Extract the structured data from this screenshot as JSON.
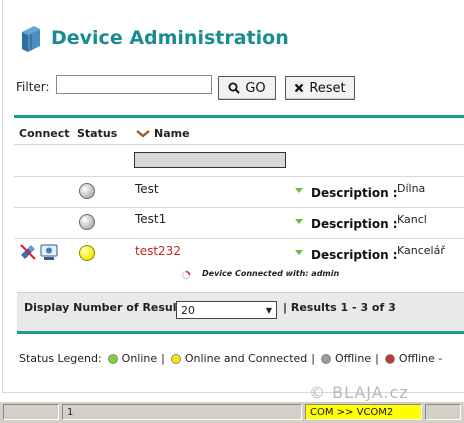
{
  "header": {
    "title": "Device Administration",
    "icon": "device-admin-icon"
  },
  "filter": {
    "label": "Filter:",
    "value": "",
    "go_label": "GO",
    "reset_label": "Reset"
  },
  "table": {
    "columns": {
      "connect": "Connect",
      "status": "Status",
      "name": "Name"
    },
    "rows": [
      {
        "status": "offline",
        "name": "Test",
        "desc_label": "Description :",
        "desc_value": "Dílna"
      },
      {
        "status": "offline",
        "name": "Test1",
        "desc_label": "Description :",
        "desc_value": "Kancl"
      },
      {
        "status": "online-connected",
        "name": "test232",
        "desc_label": "Description :",
        "desc_value": "Kancelář",
        "note": "Device Connected with: admin"
      }
    ]
  },
  "footer": {
    "display_label": "Display Number of Results",
    "page_size": "20",
    "results_text": "|  Results 1 - 3 of 3"
  },
  "legend": {
    "label": "Status Legend:",
    "items": [
      {
        "text": "Online",
        "color": "#7fcf3a"
      },
      {
        "text": "Online and Connected",
        "color": "#f0ec00"
      },
      {
        "text": "Offline",
        "color": "#9a9a9a"
      },
      {
        "text": "Offline -",
        "color": "#c0392b"
      }
    ]
  },
  "watermark": "© BLAJA.cz",
  "statusbar": {
    "field1": "1",
    "com": "COM >> VCOM2"
  },
  "colors": {
    "accent": "#1a8c91",
    "rule": "#1a9a93",
    "error_name": "#c8241c"
  }
}
